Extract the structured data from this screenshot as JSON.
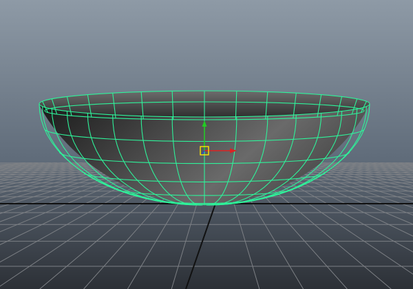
{
  "viewport": {
    "panel": "perspective",
    "background": {
      "top": "#8e9aa6",
      "bottom": "#2c3036"
    },
    "grid": {
      "visible": true,
      "line_color": "#7d8085",
      "axis_color": "#111111"
    }
  },
  "selection": {
    "object": "hemisphere bowl",
    "wireframe_on_shaded": true,
    "wireframe_color": "#2ef39a",
    "shading": {
      "outer_light": "#6a6a6a",
      "outer_dark": "#1a1a1a",
      "inner_light": "#6d6d6d",
      "inner_dark": "#303030"
    }
  },
  "manipulator": {
    "tool": "move-tool",
    "x_axis_color": "#dd2222",
    "y_axis_color": "#22cc22",
    "center_handle_color": "#ffe500"
  }
}
